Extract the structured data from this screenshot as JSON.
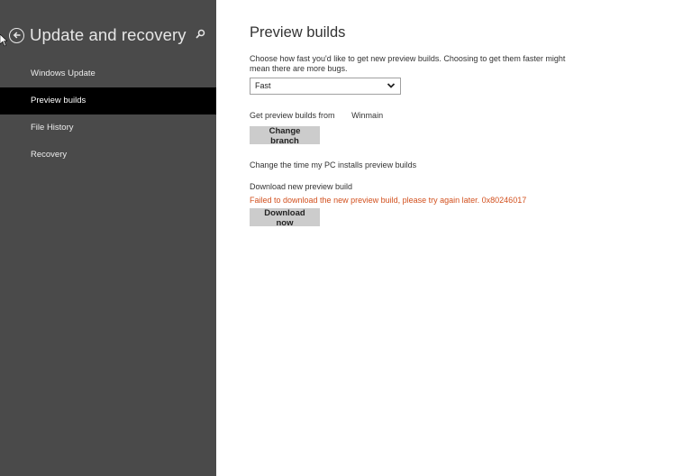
{
  "sidebar": {
    "title": "Update and recovery",
    "back_icon": "back-arrow-circle-icon",
    "search_icon": "search-icon",
    "items": [
      {
        "label": "Windows Update",
        "active": false
      },
      {
        "label": "Preview builds",
        "active": true
      },
      {
        "label": "File History",
        "active": false
      },
      {
        "label": "Recovery",
        "active": false
      }
    ]
  },
  "main": {
    "title": "Preview builds",
    "speed_description": "Choose how fast you'd like to get new preview builds. Choosing to get them faster might mean there are more bugs.",
    "speed_select": {
      "value": "Fast"
    },
    "branch_label": "Get preview builds from",
    "branch_value": "Winmain",
    "change_branch_button": "Change branch",
    "install_time_link": "Change the time my PC installs preview builds",
    "download_label": "Download new preview build",
    "error_message": "Failed to download the new preview build, please try again later. 0x80246017",
    "download_button": "Download now"
  },
  "colors": {
    "sidebar_bg": "#4a4a4a",
    "active_item_bg": "#000000",
    "error": "#d2501e",
    "button_bg": "#cccccc"
  }
}
